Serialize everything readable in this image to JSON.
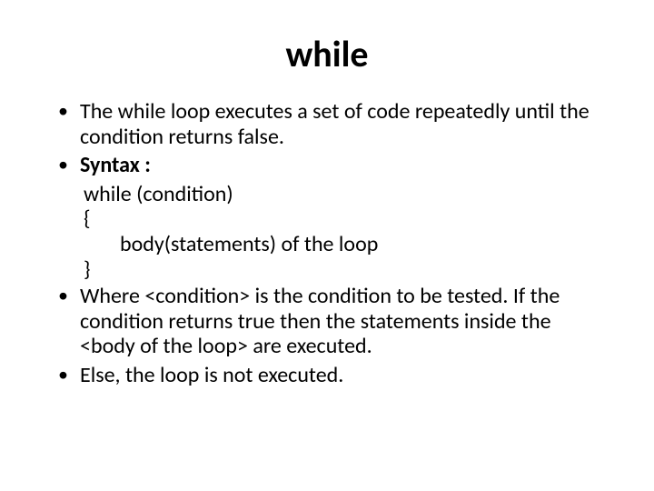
{
  "title": "while",
  "bullets": {
    "b1": "The while loop executes a set of code repeatedly until the condition returns false.",
    "b2_label": "Syntax :",
    "b3": "Where <condition> is the condition to be tested. If the condition returns true then the statements inside the <body of the loop> are executed.",
    "b4": "Else, the loop is not executed."
  },
  "code": {
    "l1": "while (condition)",
    "l2": "{",
    "l3": "body(statements) of the loop",
    "l4": "}"
  }
}
